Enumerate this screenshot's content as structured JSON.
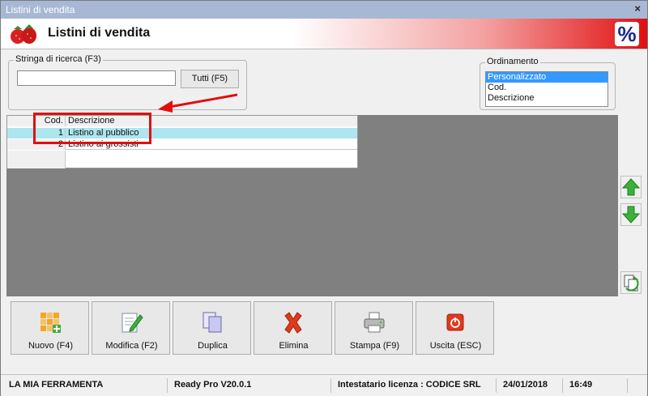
{
  "window": {
    "title": "Listini di vendita",
    "close_label": "×"
  },
  "header": {
    "title": "Listini di vendita",
    "badge": "%"
  },
  "search": {
    "group_label": "Stringa di ricerca (F3)",
    "value": "",
    "placeholder": "",
    "tutti_label": "Tutti (F5)"
  },
  "sort": {
    "group_label": "Ordinamento",
    "options": [
      "Personalizzato",
      "Cod.",
      "Descrizione"
    ],
    "selected": "Personalizzato"
  },
  "grid": {
    "columns": [
      "Cod.",
      "Descrizione"
    ],
    "rows": [
      {
        "cod": "1",
        "descrizione": "Listino al pubblico"
      },
      {
        "cod": "2",
        "descrizione": "Listino ai grossisti"
      }
    ]
  },
  "toolbar": {
    "nuovo": "Nuovo (F4)",
    "modifica": "Modifica (F2)",
    "duplica": "Duplica",
    "elimina": "Elimina",
    "stampa": "Stampa (F9)",
    "uscita": "Uscita (ESC)"
  },
  "icons": {
    "up": "arrow-up-icon",
    "down": "arrow-down-icon",
    "refresh": "refresh-icon"
  },
  "status": {
    "company": "LA MIA FERRAMENTA",
    "version": "Ready Pro V20.0.1",
    "license": "Intestatario licenza : CODICE SRL",
    "date": "24/01/2018",
    "time": "16:49"
  },
  "colors": {
    "accent_red": "#e01010",
    "selection_cyan": "#aee6f0",
    "list_selected": "#3399ff"
  }
}
